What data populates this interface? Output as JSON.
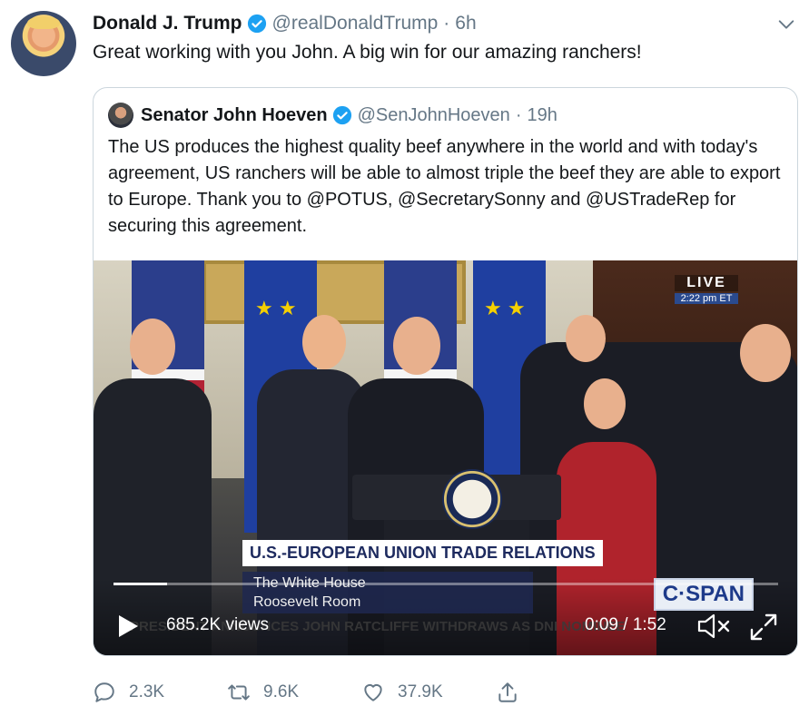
{
  "tweet": {
    "author_name": "Donald J. Trump",
    "handle": "@realDonaldTrump",
    "separator": "·",
    "time": "6h",
    "text": "Great working with you John. A big win for our amazing ranchers!"
  },
  "quoted_tweet": {
    "author_name": "Senator John Hoeven",
    "handle": "@SenJohnHoeven",
    "separator": "·",
    "time": "19h",
    "text": "The US produces the highest quality beef anywhere in the world and with today's agreement, US ranchers will be able to almost triple the beef they are able to export to Europe. Thank you to @POTUS, @SecretarySonny and @USTradeRep for securing this agreement."
  },
  "video": {
    "live_label": "LIVE",
    "live_time": "2:22 pm ET",
    "lower_third_title": "U.S.-EUROPEAN UNION TRADE RELATIONS",
    "lower_third_line1": "The White House",
    "lower_third_line2": "Roosevelt Room",
    "network_logo": "C·SPAN",
    "ticker": "PRESIDENT ANNOUNCES JOHN RATCLIFFE WITHDRAWS AS DNI NOMINEE",
    "views": "685.2K views",
    "timer": "0:09 / 1:52",
    "progress": 0.08
  },
  "actions": {
    "reply_count": "2.3K",
    "retweet_count": "9.6K",
    "like_count": "37.9K"
  },
  "icons": {
    "verified": "verified-badge-icon",
    "menu": "chevron-down-icon",
    "play": "play-icon",
    "mute": "volume-muted-icon",
    "fullscreen": "fullscreen-icon",
    "reply": "reply-icon",
    "retweet": "retweet-icon",
    "like": "heart-icon",
    "share": "share-icon"
  },
  "colors": {
    "verified_blue": "#1da1f2",
    "secondary_text": "#657786",
    "border": "#ccd6dd"
  }
}
